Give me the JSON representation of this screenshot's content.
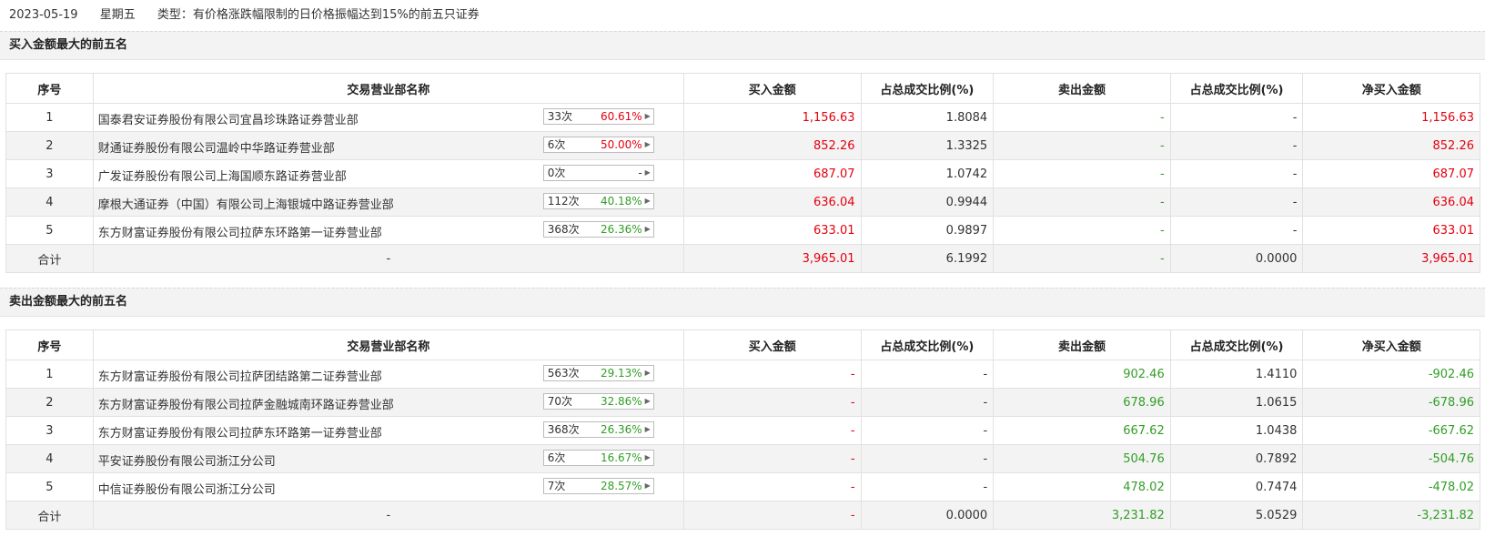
{
  "info": {
    "date": "2023-05-19",
    "weekday": "星期五",
    "type": "类型：有价格涨跌幅限制的日价格振幅达到15%的前五只证券"
  },
  "headers": [
    "序号",
    "交易营业部名称",
    "买入金额",
    "占总成交比例(%)",
    "卖出金额",
    "占总成交比例(%)",
    "净买入金额"
  ],
  "buy_section": {
    "title": "买入金额最大的前五名",
    "rows": [
      {
        "rank": "1",
        "name": "国泰君安证券股份有限公司宜昌珍珠路证券营业部",
        "count": "33次",
        "pct": "60.61%",
        "pct_color": "red",
        "buy": "1,156.63",
        "buy_ratio": "1.8084",
        "sell": "-",
        "sell_ratio": "-",
        "net": "1,156.63"
      },
      {
        "rank": "2",
        "name": "财通证券股份有限公司温岭中华路证券营业部",
        "count": "6次",
        "pct": "50.00%",
        "pct_color": "red",
        "buy": "852.26",
        "buy_ratio": "1.3325",
        "sell": "-",
        "sell_ratio": "-",
        "net": "852.26"
      },
      {
        "rank": "3",
        "name": "广发证券股份有限公司上海国顺东路证券营业部",
        "count": "0次",
        "pct": "-",
        "pct_color": "dark",
        "buy": "687.07",
        "buy_ratio": "1.0742",
        "sell": "-",
        "sell_ratio": "-",
        "net": "687.07"
      },
      {
        "rank": "4",
        "name": "摩根大通证券（中国）有限公司上海银城中路证券营业部",
        "count": "112次",
        "pct": "40.18%",
        "pct_color": "green",
        "buy": "636.04",
        "buy_ratio": "0.9944",
        "sell": "-",
        "sell_ratio": "-",
        "net": "636.04"
      },
      {
        "rank": "5",
        "name": "东方财富证券股份有限公司拉萨东环路第一证券营业部",
        "count": "368次",
        "pct": "26.36%",
        "pct_color": "green",
        "buy": "633.01",
        "buy_ratio": "0.9897",
        "sell": "-",
        "sell_ratio": "-",
        "net": "633.01"
      }
    ],
    "total": {
      "label": "合计",
      "name": "-",
      "buy": "3,965.01",
      "buy_ratio": "6.1992",
      "sell": "-",
      "sell_ratio": "0.0000",
      "net": "3,965.01"
    }
  },
  "sell_section": {
    "title": "卖出金额最大的前五名",
    "rows": [
      {
        "rank": "1",
        "name": "东方财富证券股份有限公司拉萨团结路第二证券营业部",
        "count": "563次",
        "pct": "29.13%",
        "pct_color": "green",
        "buy": "-",
        "buy_ratio": "-",
        "sell": "902.46",
        "sell_ratio": "1.4110",
        "net": "-902.46"
      },
      {
        "rank": "2",
        "name": "东方财富证券股份有限公司拉萨金融城南环路证券营业部",
        "count": "70次",
        "pct": "32.86%",
        "pct_color": "green",
        "buy": "-",
        "buy_ratio": "-",
        "sell": "678.96",
        "sell_ratio": "1.0615",
        "net": "-678.96"
      },
      {
        "rank": "3",
        "name": "东方财富证券股份有限公司拉萨东环路第一证券营业部",
        "count": "368次",
        "pct": "26.36%",
        "pct_color": "green",
        "buy": "-",
        "buy_ratio": "-",
        "sell": "667.62",
        "sell_ratio": "1.0438",
        "net": "-667.62"
      },
      {
        "rank": "4",
        "name": "平安证券股份有限公司浙江分公司",
        "count": "6次",
        "pct": "16.67%",
        "pct_color": "green",
        "buy": "-",
        "buy_ratio": "-",
        "sell": "504.76",
        "sell_ratio": "0.7892",
        "net": "-504.76"
      },
      {
        "rank": "5",
        "name": "中信证券股份有限公司浙江分公司",
        "count": "7次",
        "pct": "28.57%",
        "pct_color": "green",
        "buy": "-",
        "buy_ratio": "-",
        "sell": "478.02",
        "sell_ratio": "0.7474",
        "net": "-478.02"
      }
    ],
    "total": {
      "label": "合计",
      "name": "-",
      "buy": "-",
      "buy_ratio": "0.0000",
      "sell": "3,231.82",
      "sell_ratio": "5.0529",
      "net": "-3,231.82"
    }
  },
  "colors": {
    "up": "#e4000f",
    "down": "#319e26",
    "neutral": "#333333",
    "row_alt": "#f3f3f3"
  },
  "icons": {
    "badge_arrow": "triangle-right-icon"
  }
}
